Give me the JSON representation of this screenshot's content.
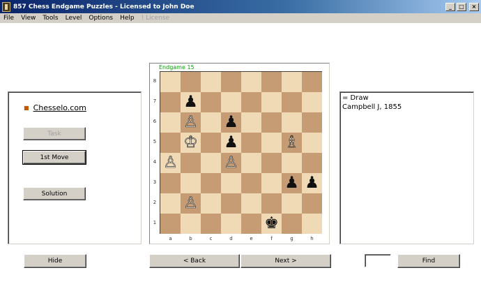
{
  "window": {
    "title": "857 Chess Endgame Puzzles - Licensed to John Doe",
    "controls": {
      "minimize": "_",
      "maximize": "□",
      "close": "×"
    }
  },
  "menu": [
    {
      "label": "File",
      "enabled": true
    },
    {
      "label": "View",
      "enabled": true
    },
    {
      "label": "Tools",
      "enabled": true
    },
    {
      "label": "Level",
      "enabled": true
    },
    {
      "label": "Options",
      "enabled": true
    },
    {
      "label": "Help",
      "enabled": true
    },
    {
      "label": "! License",
      "enabled": false
    }
  ],
  "left_panel": {
    "link": "Chesselo.com",
    "task_button": "Task",
    "first_move_button": "1st Move",
    "solution_button": "Solution"
  },
  "board": {
    "title": "Endgame 15",
    "ranks": [
      "8",
      "7",
      "6",
      "5",
      "4",
      "3",
      "2",
      "1"
    ],
    "files": [
      "a",
      "b",
      "c",
      "d",
      "e",
      "f",
      "g",
      "h"
    ],
    "pieces": [
      {
        "square": "b7",
        "glyph": "♟",
        "color": "black"
      },
      {
        "square": "b6",
        "glyph": "♙",
        "color": "white"
      },
      {
        "square": "d6",
        "glyph": "♟",
        "color": "black"
      },
      {
        "square": "b5",
        "glyph": "♔",
        "color": "white"
      },
      {
        "square": "d5",
        "glyph": "♟",
        "color": "black"
      },
      {
        "square": "g5",
        "glyph": "♗",
        "color": "white"
      },
      {
        "square": "a4",
        "glyph": "♙",
        "color": "white"
      },
      {
        "square": "d4",
        "glyph": "♙",
        "color": "white"
      },
      {
        "square": "g3",
        "glyph": "♟",
        "color": "black"
      },
      {
        "square": "h3",
        "glyph": "♟",
        "color": "black"
      },
      {
        "square": "b2",
        "glyph": "♙",
        "color": "white"
      },
      {
        "square": "f1",
        "glyph": "♚",
        "color": "black"
      }
    ]
  },
  "right_panel": {
    "lines": [
      "= Draw",
      "Campbell J, 1855"
    ]
  },
  "bottom": {
    "hide_button": "Hide",
    "back_button": "< Back",
    "next_button": "Next >",
    "find_value": "",
    "find_button": "Find"
  }
}
